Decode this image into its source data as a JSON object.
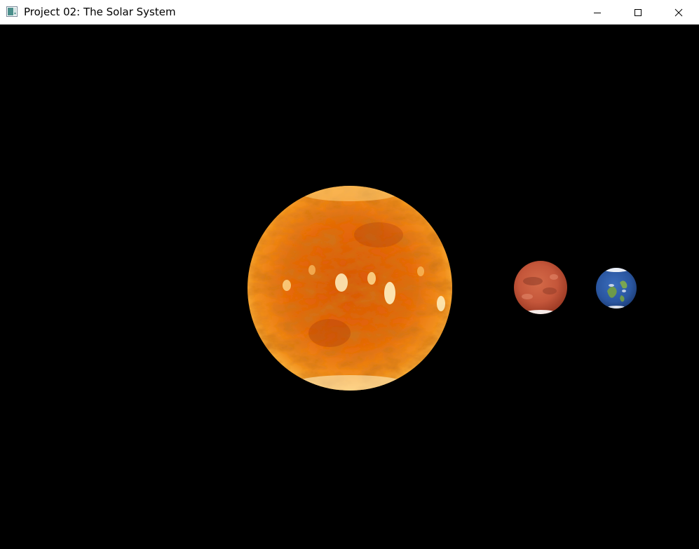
{
  "window": {
    "title": "Project 02: The Solar System",
    "app_icon": "opengl-window-icon",
    "controls": {
      "minimize_icon": "minimize-icon",
      "maximize_icon": "maximize-icon",
      "close_icon": "close-icon"
    }
  },
  "scene": {
    "background": "#000000",
    "bodies": [
      {
        "name": "sun",
        "base_color": "#e8730f",
        "highlight_color": "#ffe9a8",
        "shadow_color": "#a33a02"
      },
      {
        "name": "mars",
        "base_color": "#c4563a",
        "highlight_color": "#e08a66",
        "shadow_color": "#8a2e1c"
      },
      {
        "name": "earth",
        "base_color": "#2c5aa8",
        "land_color": "#6e9a4a",
        "cloud_color": "#ffffff"
      }
    ]
  }
}
